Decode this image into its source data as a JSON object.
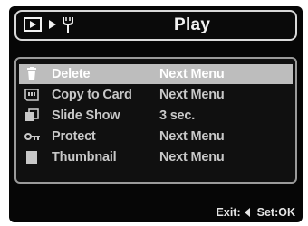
{
  "header": {
    "title": "Play",
    "icons": [
      "playback-mode-icon",
      "right-arrow-icon",
      "wrench-icon"
    ]
  },
  "menu": {
    "items": [
      {
        "label": "Delete",
        "value": "Next Menu",
        "icon": "trash-icon",
        "selected": true
      },
      {
        "label": "Copy to Card",
        "value": "Next Menu",
        "icon": "memory-card-icon",
        "selected": false
      },
      {
        "label": "Slide Show",
        "value": "3 sec.",
        "icon": "slideshow-icon",
        "selected": false
      },
      {
        "label": "Protect",
        "value": "Next Menu",
        "icon": "key-icon",
        "selected": false
      },
      {
        "label": "Thumbnail",
        "value": "Next Menu",
        "icon": "thumbnail-icon",
        "selected": false
      }
    ]
  },
  "footer": {
    "exit_label": "Exit:",
    "set_label": "Set:OK"
  },
  "colors": {
    "background": "#060606",
    "highlight": "#bdbdbd",
    "text": "#c8c8c8"
  }
}
